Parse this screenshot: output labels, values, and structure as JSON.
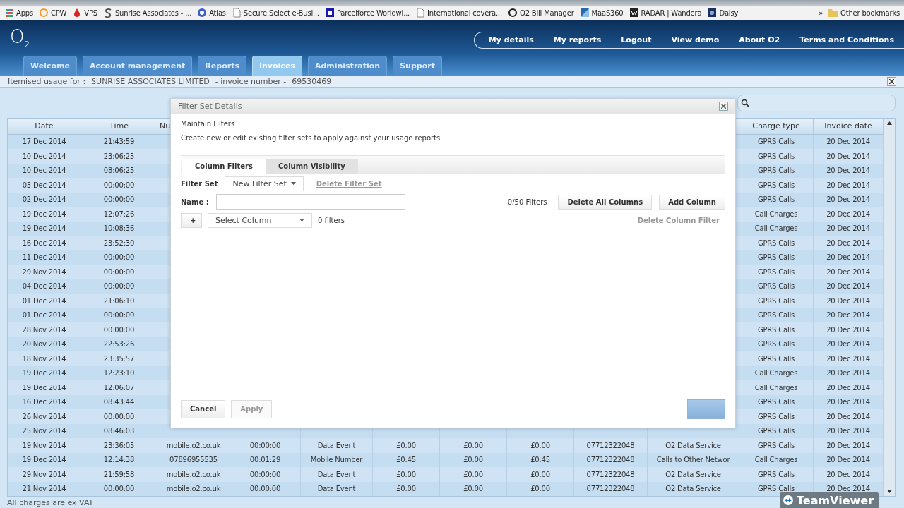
{
  "bookmarks": [
    {
      "label": "Apps",
      "kind": "apps"
    },
    {
      "label": "CPW",
      "kind": "ring"
    },
    {
      "label": "VPS",
      "kind": "drop"
    },
    {
      "label": "Sunrise Associates - ...",
      "kind": "swirl"
    },
    {
      "label": "Atlas",
      "kind": "globe"
    },
    {
      "label": "Secure Select e-Busi...",
      "kind": "page"
    },
    {
      "label": "Parcelforce Worldwi...",
      "kind": "square"
    },
    {
      "label": "International covera...",
      "kind": "page"
    },
    {
      "label": "O2 Bill Manager",
      "kind": "ring-dark"
    },
    {
      "label": "MaaS360",
      "kind": "tile"
    },
    {
      "label": "RADAR | Wandera",
      "kind": "dark"
    },
    {
      "label": "Daisy",
      "kind": "navy"
    }
  ],
  "bookmarks_more": "»",
  "other_bookmarks": "Other bookmarks",
  "logo": "O$_{2}$",
  "top_links": [
    "My details",
    "My reports",
    "Logout",
    "View demo",
    "About O2",
    "Terms and Conditions"
  ],
  "tabs": [
    {
      "label": "Welcome",
      "selected": false
    },
    {
      "label": "Account management",
      "selected": false
    },
    {
      "label": "Reports",
      "selected": false
    },
    {
      "label": "Invoices",
      "selected": true
    },
    {
      "label": "Administration",
      "selected": false
    },
    {
      "label": "Support",
      "selected": false
    }
  ],
  "info_bar": {
    "label": "Itemised usage for :",
    "customer": "SUNRISE ASSOCIATES LIMITED",
    "invoice_label": "- invoice number -",
    "invoice_number": "69530469"
  },
  "table": {
    "columns_left": [
      "Date",
      "Time",
      "Nu"
    ],
    "columns_right": [
      "Charge type",
      "Invoice date"
    ],
    "rows": [
      {
        "kind": "partial",
        "date": "17 Dec 2014",
        "time": "21:43:59",
        "charge_type": "GPRS Calls",
        "invoice_date": "20 Dec 2014"
      },
      {
        "kind": "partial",
        "date": "10 Dec 2014",
        "time": "23:06:25",
        "charge_type": "GPRS Calls",
        "invoice_date": "20 Dec 2014"
      },
      {
        "kind": "partial",
        "date": "10 Dec 2014",
        "time": "08:06:25",
        "charge_type": "GPRS Calls",
        "invoice_date": "20 Dec 2014"
      },
      {
        "kind": "partial",
        "date": "03 Dec 2014",
        "time": "00:00:00",
        "charge_type": "GPRS Calls",
        "invoice_date": "20 Dec 2014"
      },
      {
        "kind": "partial",
        "date": "02 Dec 2014",
        "time": "00:00:00",
        "charge_type": "GPRS Calls",
        "invoice_date": "20 Dec 2014"
      },
      {
        "kind": "partial",
        "date": "19 Dec 2014",
        "time": "12:07:26",
        "charge_type": "Call Charges",
        "invoice_date": "20 Dec 2014"
      },
      {
        "kind": "partial",
        "date": "19 Dec 2014",
        "time": "10:08:36",
        "charge_type": "Call Charges",
        "invoice_date": "20 Dec 2014"
      },
      {
        "kind": "partial",
        "date": "16 Dec 2014",
        "time": "23:52:30",
        "charge_type": "GPRS Calls",
        "invoice_date": "20 Dec 2014"
      },
      {
        "kind": "partial",
        "date": "11 Dec 2014",
        "time": "00:00:00",
        "charge_type": "GPRS Calls",
        "invoice_date": "20 Dec 2014"
      },
      {
        "kind": "partial",
        "date": "29 Nov 2014",
        "time": "00:00:00",
        "charge_type": "GPRS Calls",
        "invoice_date": "20 Dec 2014"
      },
      {
        "kind": "partial",
        "date": "04 Dec 2014",
        "time": "00:00:00",
        "charge_type": "GPRS Calls",
        "invoice_date": "20 Dec 2014"
      },
      {
        "kind": "partial",
        "date": "01 Dec 2014",
        "time": "21:06:10",
        "charge_type": "GPRS Calls",
        "invoice_date": "20 Dec 2014"
      },
      {
        "kind": "partial",
        "date": "01 Dec 2014",
        "time": "00:00:00",
        "charge_type": "GPRS Calls",
        "invoice_date": "20 Dec 2014"
      },
      {
        "kind": "partial",
        "date": "28 Nov 2014",
        "time": "00:00:00",
        "charge_type": "GPRS Calls",
        "invoice_date": "20 Dec 2014"
      },
      {
        "kind": "partial",
        "date": "20 Nov 2014",
        "time": "22:53:26",
        "charge_type": "GPRS Calls",
        "invoice_date": "20 Dec 2014"
      },
      {
        "kind": "partial",
        "date": "18 Nov 2014",
        "time": "23:35:57",
        "charge_type": "GPRS Calls",
        "invoice_date": "20 Dec 2014"
      },
      {
        "kind": "partial",
        "date": "19 Dec 2014",
        "time": "12:23:10",
        "charge_type": "Call Charges",
        "invoice_date": "20 Dec 2014"
      },
      {
        "kind": "partial",
        "date": "19 Dec 2014",
        "time": "12:06:07",
        "charge_type": "Call Charges",
        "invoice_date": "20 Dec 2014"
      },
      {
        "kind": "partial",
        "date": "16 Dec 2014",
        "time": "08:43:44",
        "charge_type": "GPRS Calls",
        "invoice_date": "20 Dec 2014"
      },
      {
        "kind": "partial",
        "date": "26 Nov 2014",
        "time": "00:00:00",
        "charge_type": "GPRS Calls",
        "invoice_date": "20 Dec 2014"
      },
      {
        "kind": "partial",
        "date": "25 Nov 2014",
        "time": "08:46:03",
        "charge_type": "GPRS Calls",
        "invoice_date": "20 Dec 2014"
      },
      {
        "kind": "full",
        "cells": [
          "19 Nov 2014",
          "23:36:05",
          "mobile.o2.co.uk",
          "00:00:00",
          "Data Event",
          "£0.00",
          "£0.00",
          "£0.00",
          "07712322048",
          "O2 Data Service",
          "GPRS Calls",
          "20 Dec 2014"
        ]
      },
      {
        "kind": "full",
        "cells": [
          "19 Dec 2014",
          "12:14:38",
          "07896955535",
          "00:01:29",
          "Mobile Number",
          "£0.45",
          "£0.00",
          "£0.45",
          "07712322048",
          "Calls to Other Networ",
          "Call Charges",
          "20 Dec 2014"
        ]
      },
      {
        "kind": "full",
        "cells": [
          "29 Nov 2014",
          "21:59:58",
          "mobile.o2.co.uk",
          "00:00:00",
          "Data Event",
          "£0.00",
          "£0.00",
          "£0.00",
          "07712322048",
          "O2 Data Service",
          "GPRS Calls",
          "20 Dec 2014"
        ]
      },
      {
        "kind": "full",
        "cells": [
          "21 Nov 2014",
          "00:00:00",
          "mobile.o2.co.uk",
          "00:00:00",
          "Data Event",
          "£0.00",
          "£0.00",
          "£0.00",
          "07712322048",
          "O2 Data Service",
          "GPRS Calls",
          "20 Dec 2014"
        ]
      }
    ]
  },
  "footer_note": "All charges are ex VAT",
  "dialog": {
    "title": "Filter Set Details",
    "heading": "Maintain Filters",
    "description": "Create new or edit existing filter sets to apply against your usage reports",
    "tabs": [
      {
        "label": "Column Filters",
        "selected": true
      },
      {
        "label": "Column Visibility",
        "selected": false
      }
    ],
    "filter_set_label": "Filter Set",
    "filter_set_value": "New Filter Set",
    "delete_filter_set": {
      "label": "Delete Filter Set",
      "disabled": true
    },
    "name_label": "Name :",
    "filter_count": "0/50 Filters",
    "delete_all_columns": "Delete All Columns",
    "add_column": "Add Column",
    "add_button": "+",
    "column_select": "Select Column",
    "filters_count": "0 filters",
    "delete_column_filter": {
      "label": "Delete Column Filter",
      "disabled": true
    },
    "cancel": "Cancel",
    "apply": {
      "label": "Apply",
      "disabled": true
    }
  },
  "teamviewer": "TeamViewer"
}
